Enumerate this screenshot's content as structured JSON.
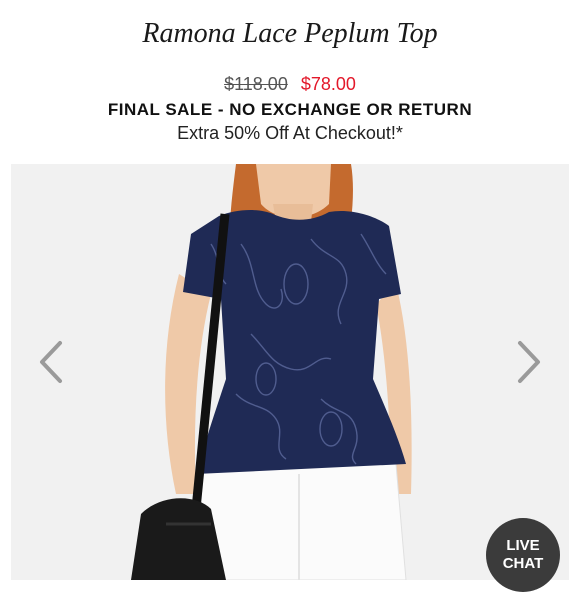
{
  "product": {
    "title": "Ramona Lace Peplum Top",
    "price_original": "$118.00",
    "price_sale": "$78.00",
    "final_sale_notice": "FINAL SALE - NO EXCHANGE OR RETURN",
    "promo": "Extra 50% Off At Checkout!*"
  },
  "gallery": {
    "prev_icon": "chevron-left-icon",
    "next_icon": "chevron-right-icon"
  },
  "chat": {
    "line1": "LIVE",
    "line2": "CHAT"
  },
  "colors": {
    "sale_red": "#e3182a",
    "navy": "#1f2a55",
    "chat_bg": "#3b3b3b"
  }
}
